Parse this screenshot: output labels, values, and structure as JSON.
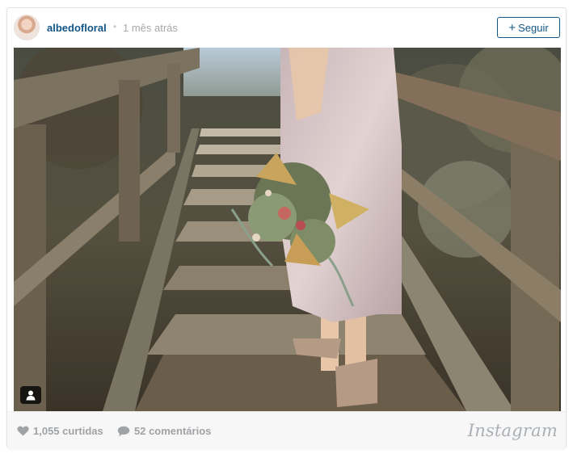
{
  "post": {
    "username": "albedofloral",
    "separator": "•",
    "time_ago": "1 mês atrás",
    "follow_label": "Seguir",
    "likes": "1,055 curtidas",
    "comments": "52 comentários",
    "brand": "Instagram"
  },
  "colors": {
    "link": "#125688",
    "muted": "#a5a7aa",
    "footer_bg": "#f7f7f7"
  },
  "icons": {
    "heart": "heart-icon",
    "comment": "comment-icon",
    "user_tag": "user-tag-icon"
  }
}
